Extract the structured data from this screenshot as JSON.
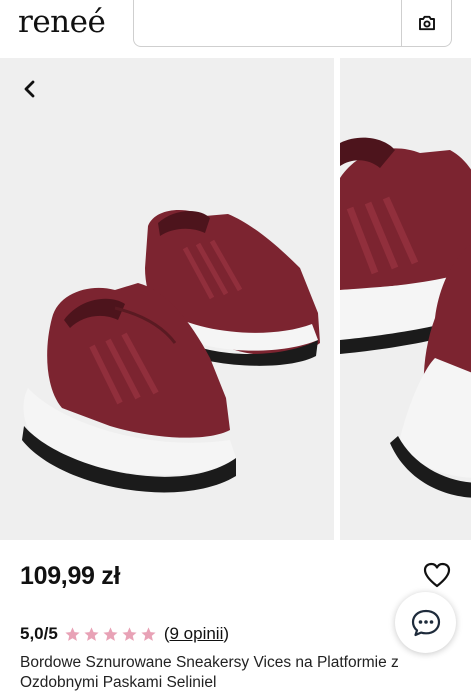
{
  "header": {
    "logo_text": "reneé",
    "search": {
      "value": "",
      "placeholder": ""
    },
    "camera_icon": "camera-icon"
  },
  "gallery": {
    "back_icon": "chevron-left-icon",
    "images": [
      {
        "alt": "Bordowe Sznurowane Sneakersy Vices na Platformie z Ozdobnymi Paskami Seliniel"
      },
      {
        "alt": "Bordowe Sznurowane Sneakersy Vices na Platformie z Ozdobnymi Paskami Seliniel"
      }
    ]
  },
  "product": {
    "price": "109,99 zł",
    "rating": {
      "score": "5,0/5",
      "stars": 5,
      "reviews_open": "(",
      "reviews_link": "9 opinii",
      "reviews_close": ")"
    },
    "title": "Bordowe Sznurowane Sneakersy Vices na Platformie z Ozdobnymi Paskami Seliniel"
  },
  "colors": {
    "star": "#e8a2b6",
    "shoe": "#7c2430",
    "background": "#efefef"
  },
  "icons": {
    "favorite": "heart-icon",
    "chat": "chat-bubble-icon"
  }
}
